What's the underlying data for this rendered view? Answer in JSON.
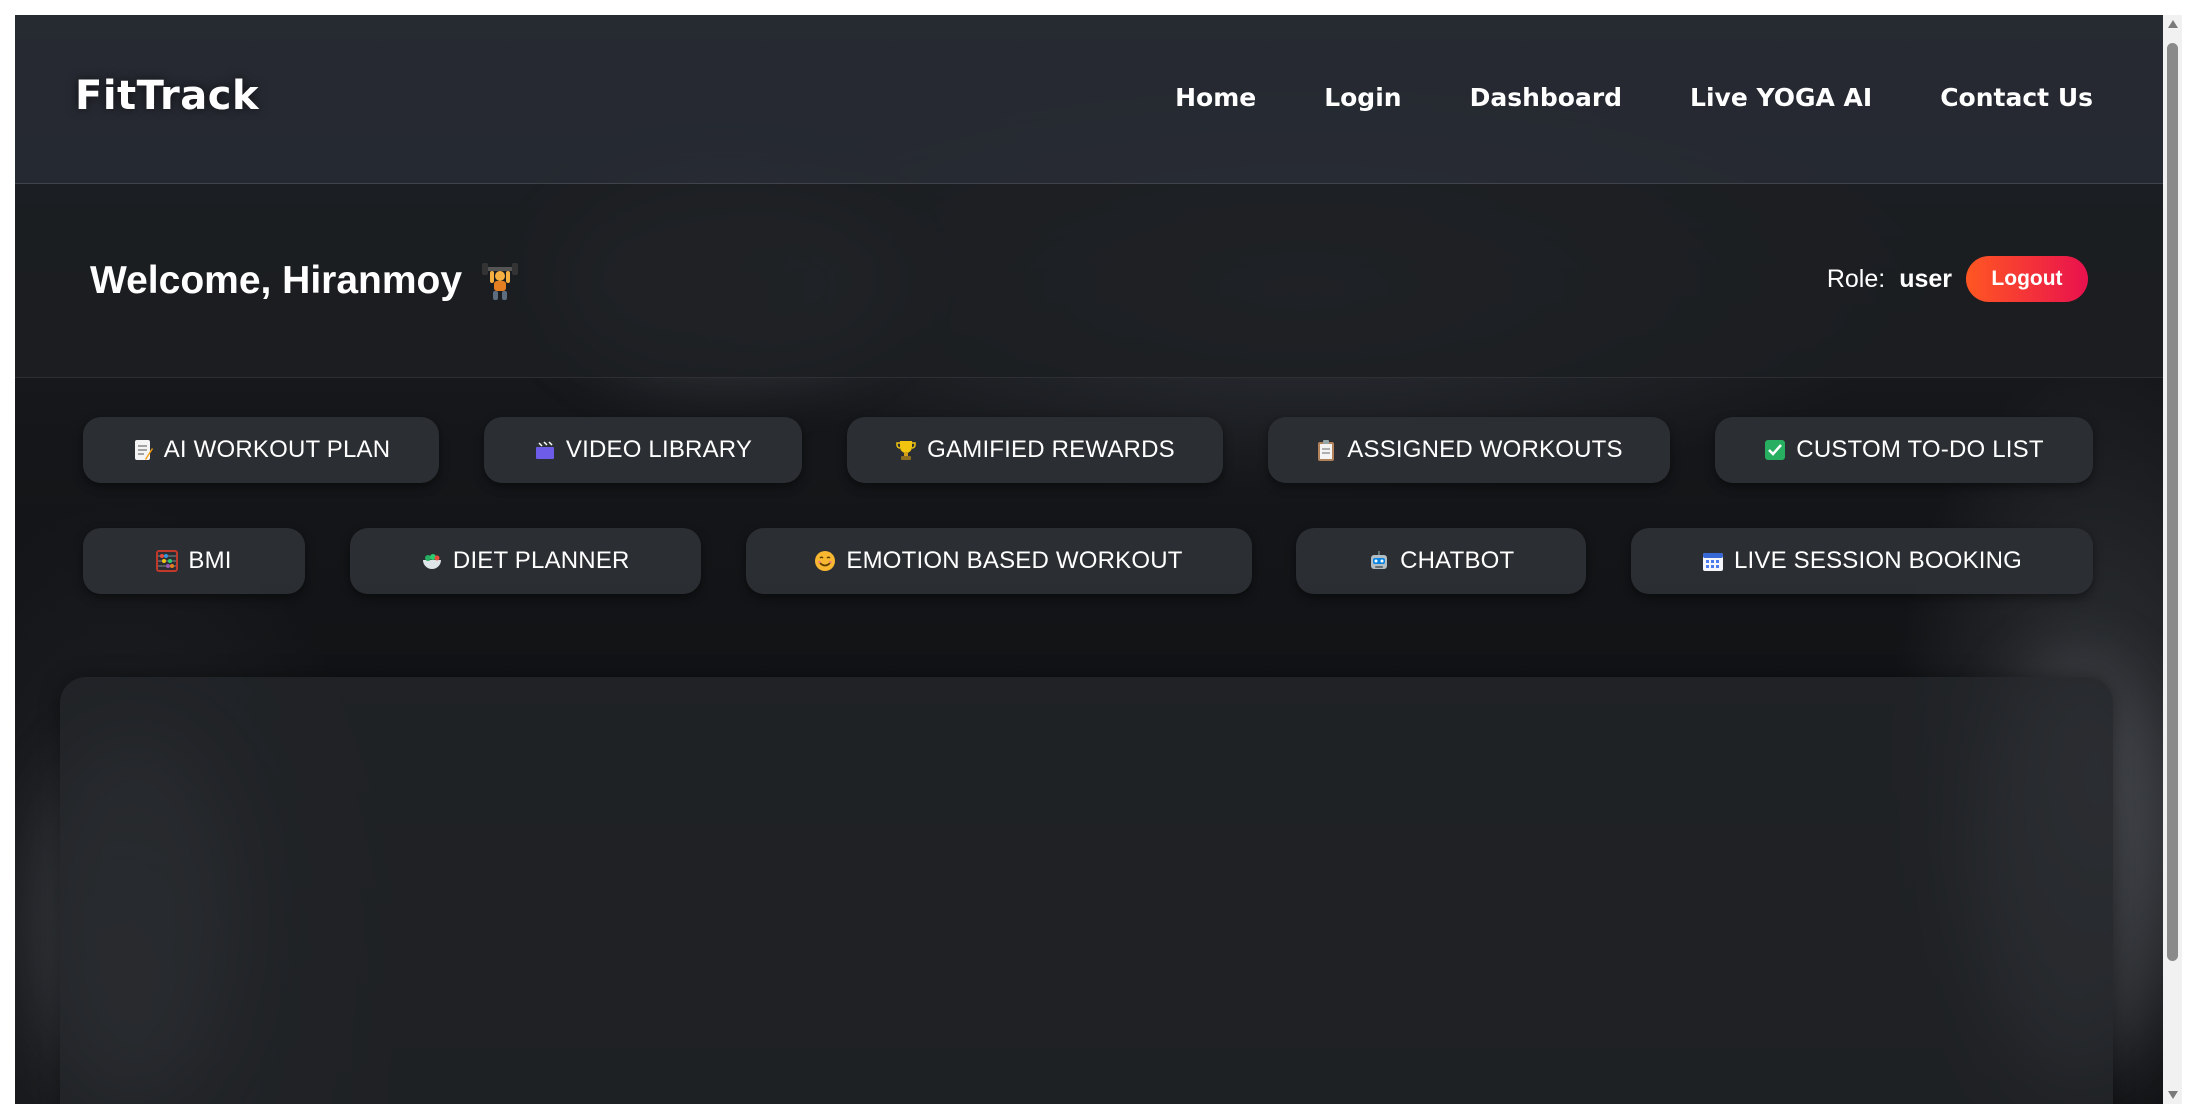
{
  "navbar": {
    "brand": "FitTrack",
    "links": [
      "Home",
      "Login",
      "Dashboard",
      "Live YOGA AI",
      "Contact Us"
    ]
  },
  "header": {
    "welcome": "Welcome, Hiranmoy",
    "welcome_icon": "weightlifter-icon",
    "role_label": "Role:",
    "role_value": "user",
    "logout_label": "Logout"
  },
  "features": {
    "row1": [
      {
        "label": "AI WORKOUT PLAN",
        "icon": "memo-icon"
      },
      {
        "label": "VIDEO LIBRARY",
        "icon": "clapperboard-icon"
      },
      {
        "label": "GAMIFIED REWARDS",
        "icon": "trophy-icon"
      },
      {
        "label": "ASSIGNED WORKOUTS",
        "icon": "clipboard-icon"
      },
      {
        "label": "CUSTOM TO-DO LIST",
        "icon": "checkmark-icon"
      }
    ],
    "row2": [
      {
        "label": "BMI",
        "icon": "abacus-icon"
      },
      {
        "label": "DIET PLANNER",
        "icon": "salad-icon"
      },
      {
        "label": "EMOTION BASED WORKOUT",
        "icon": "smiley-icon"
      },
      {
        "label": "CHATBOT",
        "icon": "robot-icon"
      },
      {
        "label": "LIVE SESSION BOOKING",
        "icon": "calendar-icon"
      }
    ]
  },
  "colors": {
    "logout_gradient_start": "#ff5722",
    "logout_gradient_end": "#e9114e",
    "pill_bg": "#2c2f34",
    "navbar_bg": "#282c34"
  }
}
